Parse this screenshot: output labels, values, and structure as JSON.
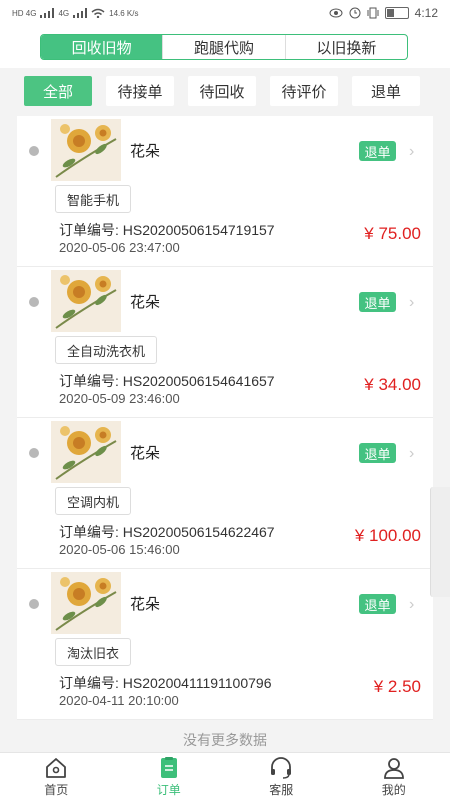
{
  "status": {
    "network_left": "HD 4G",
    "network_left2": "4G",
    "speed": "14.6 K/s",
    "time": "4:12"
  },
  "top_tabs": [
    {
      "label": "回收旧物",
      "active": true
    },
    {
      "label": "跑腿代购",
      "active": false
    },
    {
      "label": "以旧换新",
      "active": false
    }
  ],
  "filters": [
    {
      "label": "全部",
      "active": true
    },
    {
      "label": "待接单",
      "active": false
    },
    {
      "label": "待回收",
      "active": false
    },
    {
      "label": "待评价",
      "active": false
    },
    {
      "label": "退单",
      "active": false
    }
  ],
  "orders": [
    {
      "name": "花朵",
      "action": "退单",
      "tag": "智能手机",
      "order_no": "订单编号: HS20200506154719157",
      "date": "2020-05-06 23:47:00",
      "price": "¥ 75.00"
    },
    {
      "name": "花朵",
      "action": "退单",
      "tag": "全自动洗衣机",
      "order_no": "订单编号: HS20200506154641657",
      "date": "2020-05-09 23:46:00",
      "price": "¥ 34.00"
    },
    {
      "name": "花朵",
      "action": "退单",
      "tag": "空调内机",
      "order_no": "订单编号: HS20200506154622467",
      "date": "2020-05-06 15:46:00",
      "price": "¥ 100.00"
    },
    {
      "name": "花朵",
      "action": "退单",
      "tag": "淘汰旧衣",
      "order_no": "订单编号: HS20200411191100796",
      "date": "2020-04-11 20:10:00",
      "price": "¥ 2.50"
    }
  ],
  "no_more": "没有更多数据",
  "bottom_nav": [
    {
      "label": "首页",
      "icon": "home-icon",
      "active": false
    },
    {
      "label": "订单",
      "icon": "orders-icon",
      "active": true
    },
    {
      "label": "客服",
      "icon": "headset-icon",
      "active": false
    },
    {
      "label": "我的",
      "icon": "user-icon",
      "active": false
    }
  ],
  "colors": {
    "accent": "#45c282",
    "price": "#e02020"
  }
}
